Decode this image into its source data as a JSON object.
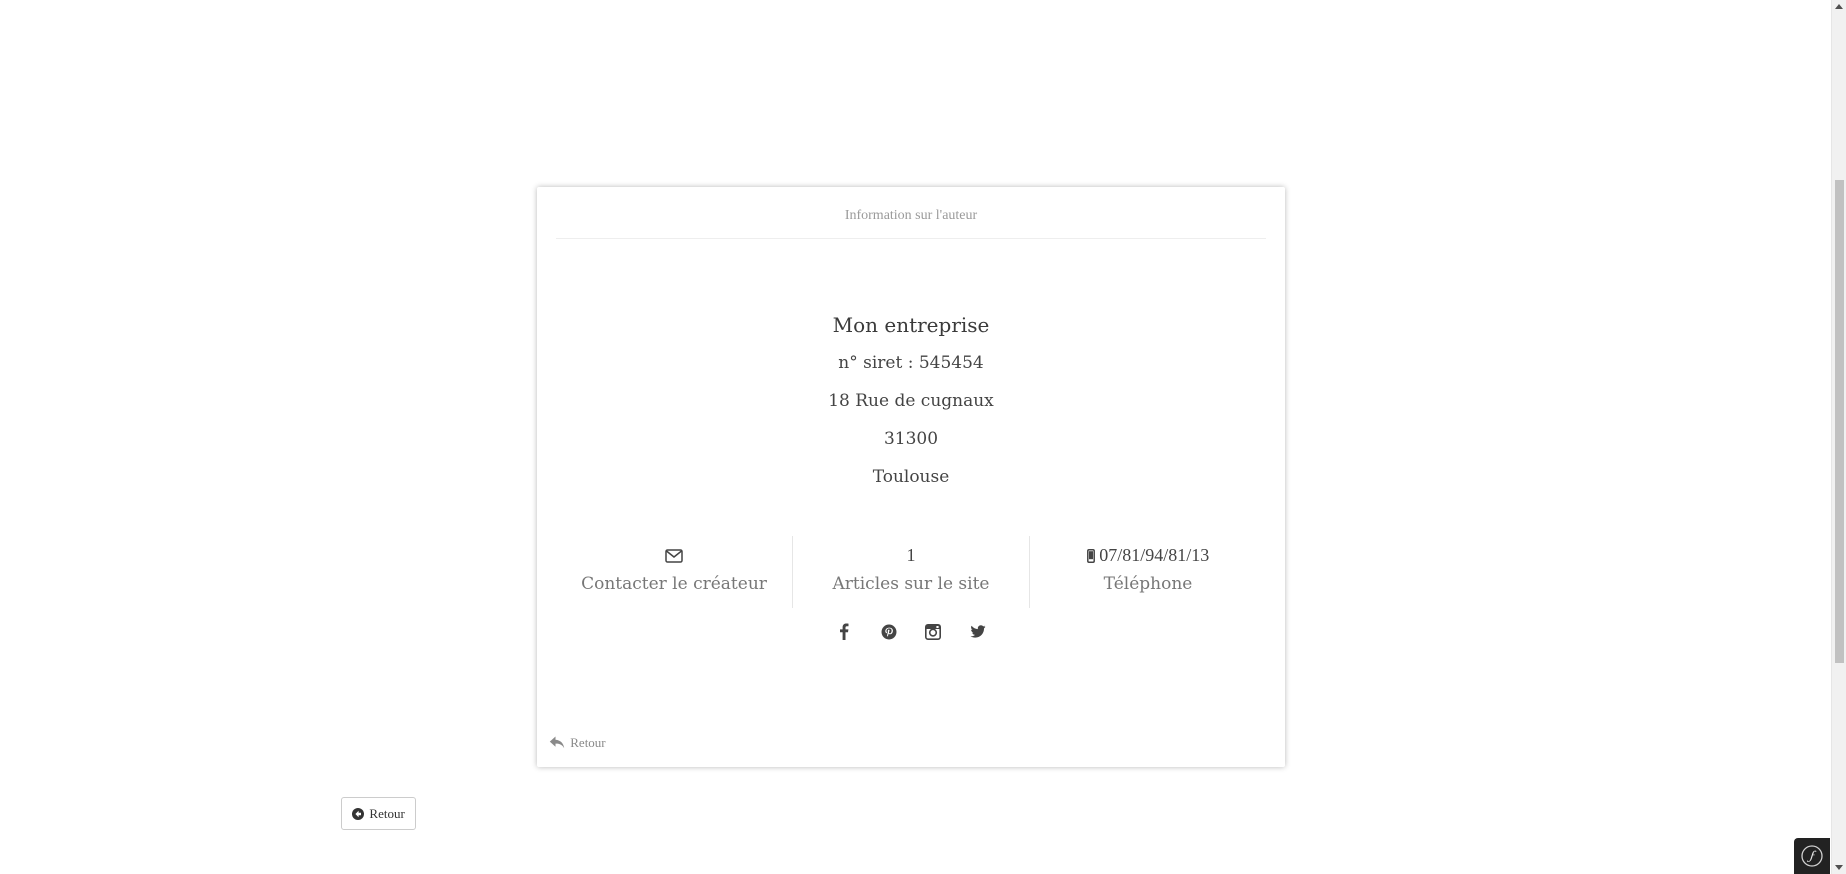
{
  "card": {
    "header": "Information sur l'auteur",
    "company": {
      "name": "Mon entreprise",
      "siret": "n° siret : 545454",
      "address": "18 Rue de cugnaux",
      "postal_code": "31300",
      "city": "Toulouse"
    },
    "stats": [
      {
        "icon": "envelope-icon",
        "value": "",
        "label": "Contacter le créateur"
      },
      {
        "icon": "",
        "value": "1",
        "label": "Articles sur le site"
      },
      {
        "icon": "mobile-phone-icon",
        "value": "07/81/94/81/13",
        "label": "Téléphone"
      }
    ],
    "socials": [
      "facebook-icon",
      "pinterest-icon",
      "instagram-icon",
      "twitter-icon"
    ],
    "back_label": "Retour"
  },
  "back_button": {
    "label": "Retour",
    "icon": "arrow-circle-left-icon"
  },
  "colors": {
    "text": "#333333",
    "muted": "#777777",
    "divider": "#eeeeee",
    "symfony_toolbar": "#222222"
  }
}
